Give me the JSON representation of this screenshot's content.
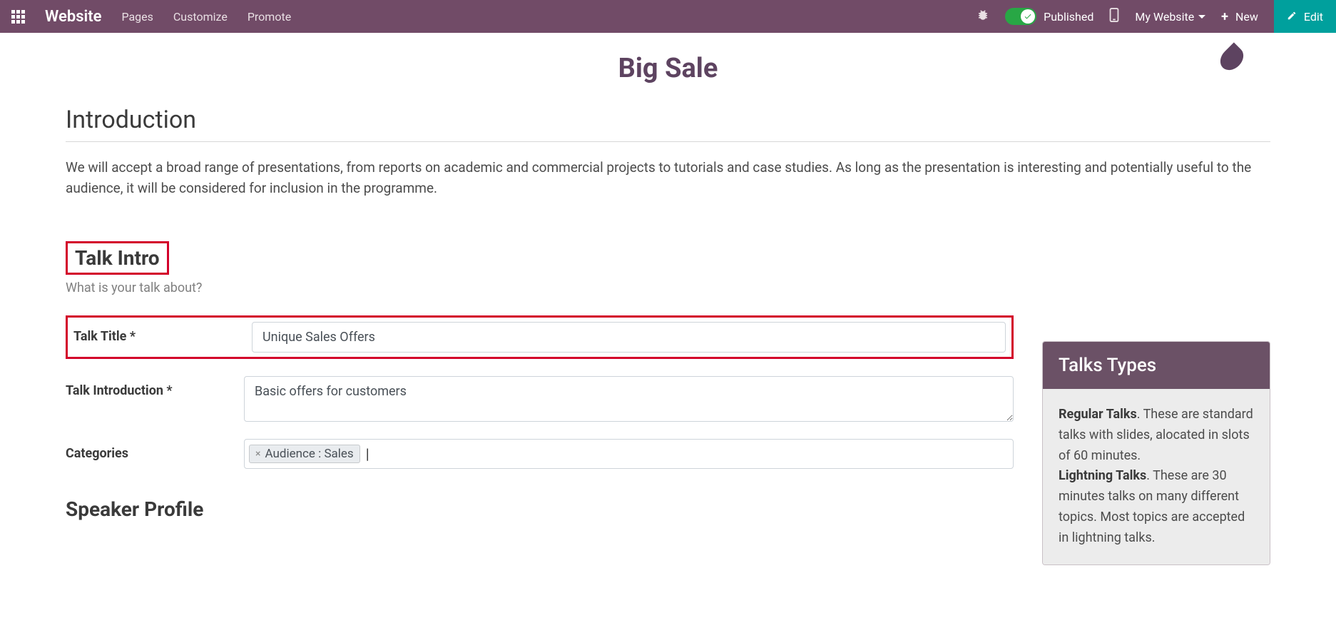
{
  "topbar": {
    "brand": "Website",
    "nav": {
      "pages": "Pages",
      "customize": "Customize",
      "promote": "Promote"
    },
    "published": "Published",
    "my_website": "My Website",
    "new": "New",
    "edit": "Edit"
  },
  "page": {
    "title": "Big Sale"
  },
  "intro": {
    "heading": "Introduction",
    "text": "We will accept a broad range of presentations, from reports on academic and commercial projects to tutorials and case studies. As long as the presentation is interesting and potentially useful to the audience, it will be considered for inclusion in the programme."
  },
  "talk_intro": {
    "heading": "Talk Intro",
    "subheading": "What is your talk about?"
  },
  "form": {
    "title_label": "Talk Title *",
    "title_value": "Unique Sales Offers",
    "introduction_label": "Talk Introduction *",
    "introduction_value": "Basic offers for customers",
    "categories_label": "Categories",
    "categories_tag": "Audience : Sales"
  },
  "speaker": {
    "heading": "Speaker Profile"
  },
  "sidebar": {
    "title": "Talks Types",
    "regular_label": "Regular Talks",
    "regular_text": ". These are standard talks with slides, alocated in slots of 60 minutes.",
    "lightning_label": "Lightning Talks",
    "lightning_text": ". These are 30 minutes talks on many different topics. Most topics are accepted in lightning talks."
  }
}
